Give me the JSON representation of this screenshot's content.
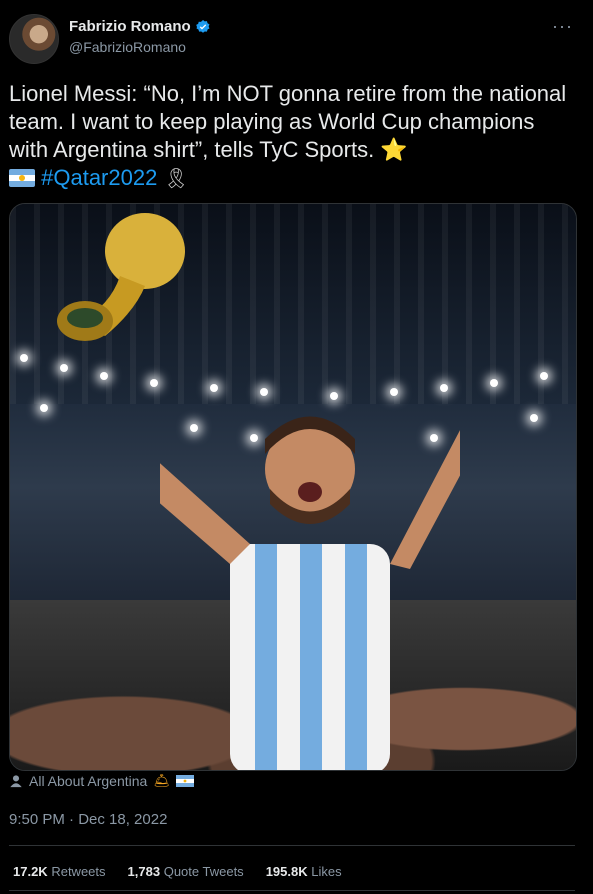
{
  "author": {
    "display_name": "Fabrizio Romano",
    "handle": "@FabrizioRomano",
    "verified_icon": "verified-badge-icon"
  },
  "tweet": {
    "text": "Lionel Messi: “No, I’m NOT gonna retire from the national team. I want to keep playing as World Cup champions with Argentina shirt”, tells TyC Sports.",
    "star": "⭐",
    "hashtag": "#Qatar2022",
    "ribbon": "🎗"
  },
  "media": {
    "description_icon": "photo",
    "attribution": "All About Argentina"
  },
  "meta": {
    "timestamp": "9:50 PM · Dec 18, 2022"
  },
  "stats": {
    "retweets_count": "17.2K",
    "retweets_label": "Retweets",
    "quotes_count": "1,783",
    "quotes_label": "Quote Tweets",
    "likes_count": "195.8K",
    "likes_label": "Likes"
  },
  "colors": {
    "background": "#000000",
    "text": "#e7e9ea",
    "secondary": "#8b98a5",
    "link": "#1d9bf0",
    "verified": "#1d9bf0"
  }
}
